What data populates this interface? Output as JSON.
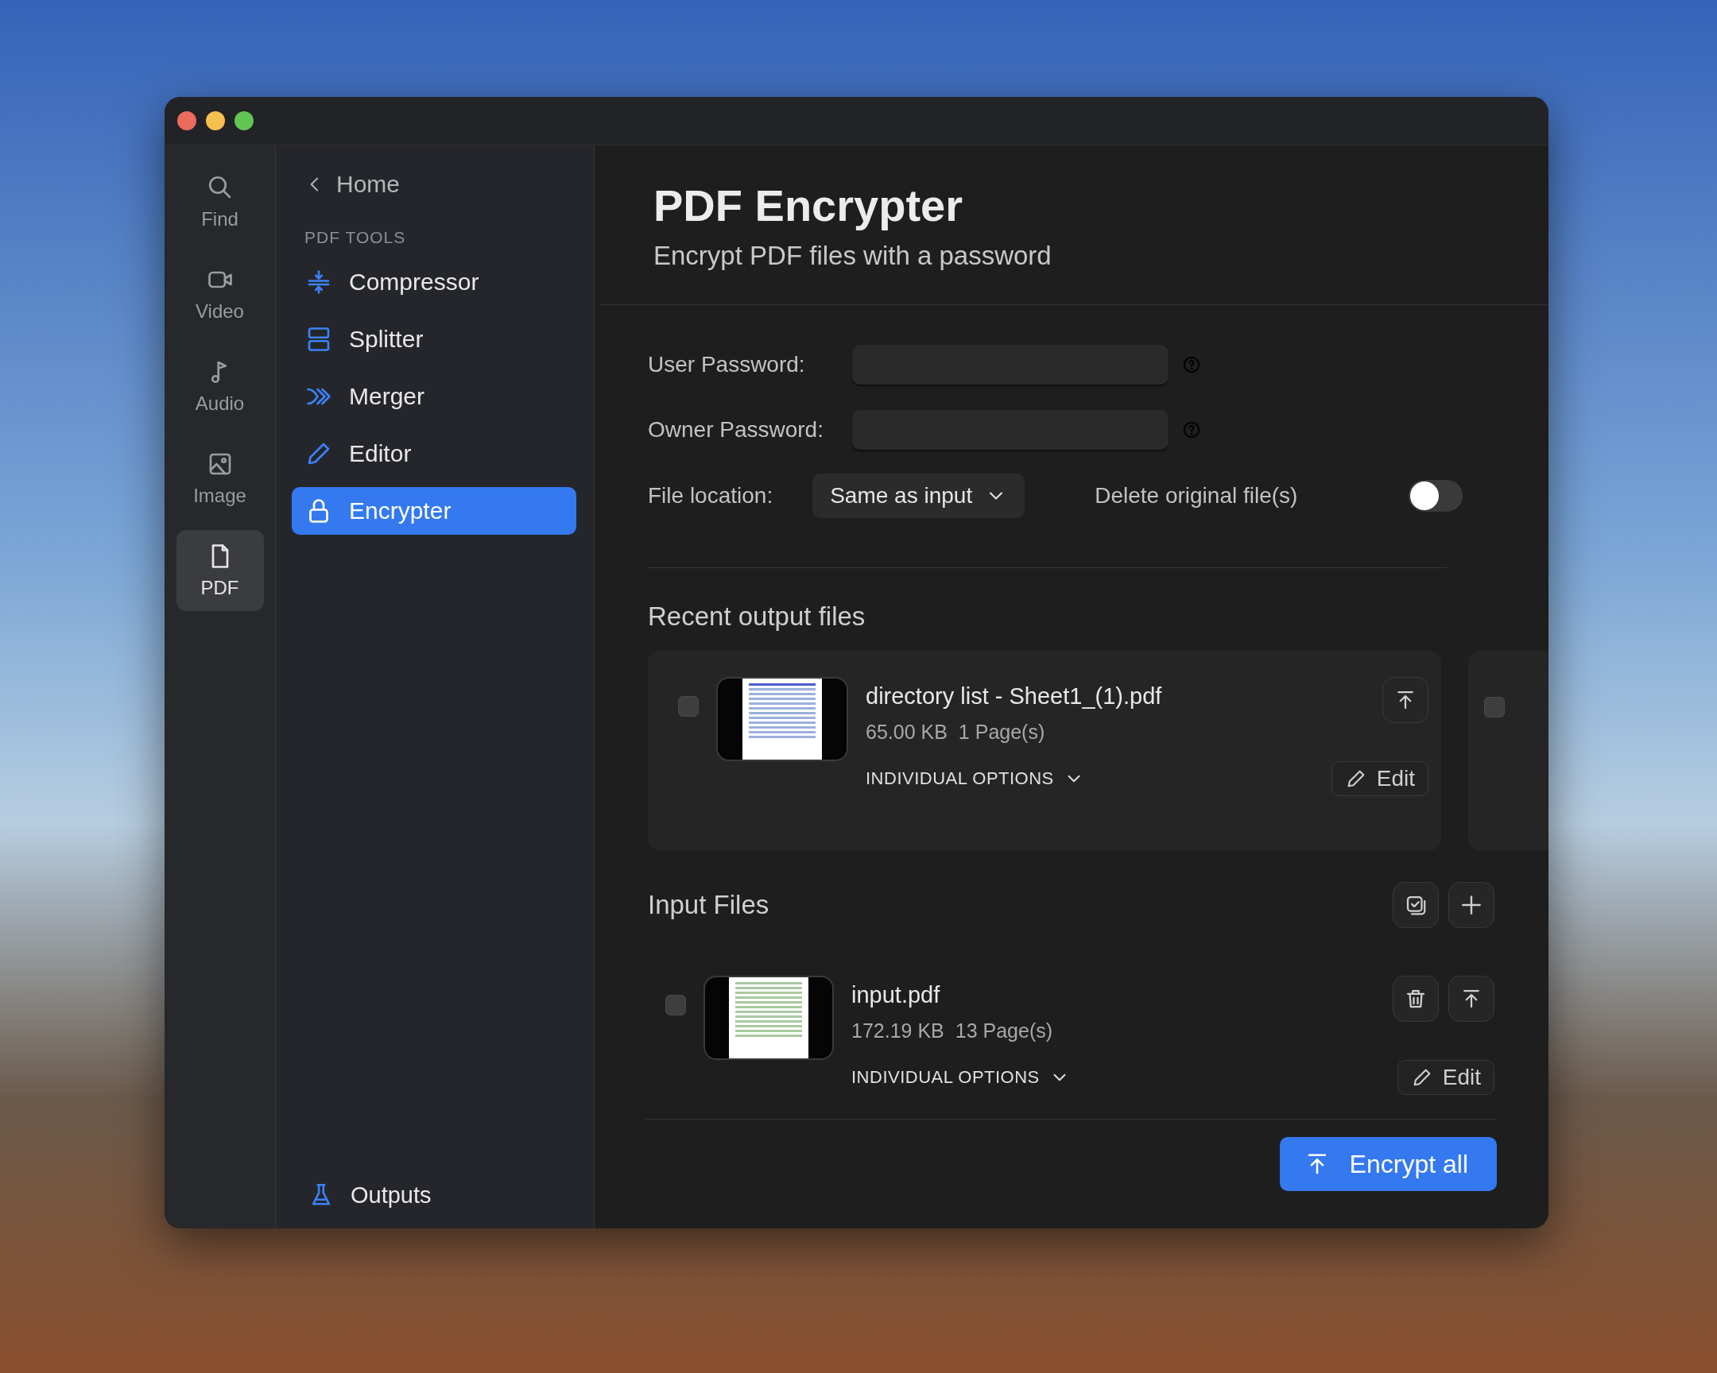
{
  "window": {
    "controls": [
      {
        "color": "#ed6a5e"
      },
      {
        "color": "#f5bf4f"
      },
      {
        "color": "#61c554"
      }
    ]
  },
  "rail": [
    {
      "label": "Find",
      "selected": false
    },
    {
      "label": "Video",
      "selected": false
    },
    {
      "label": "Audio",
      "selected": false
    },
    {
      "label": "Image",
      "selected": false
    },
    {
      "label": "PDF",
      "selected": true
    }
  ],
  "sidebar": {
    "back": "Home",
    "section": "PDF TOOLS",
    "items": [
      {
        "label": "Compressor",
        "selected": false
      },
      {
        "label": "Splitter",
        "selected": false
      },
      {
        "label": "Merger",
        "selected": false
      },
      {
        "label": "Editor",
        "selected": false
      },
      {
        "label": "Encrypter",
        "selected": true
      }
    ],
    "footer": "Outputs"
  },
  "header": {
    "title": "PDF Encrypter",
    "subtitle": "Encrypt PDF files with a password"
  },
  "form": {
    "user_password": {
      "label": "User Password:"
    },
    "owner_password": {
      "label": "Owner Password:"
    },
    "file_location": {
      "label": "File location:",
      "value": "Same as input"
    },
    "delete_original": {
      "label": "Delete original file(s)",
      "on": false
    }
  },
  "recent": {
    "title": "Recent output files",
    "files": [
      {
        "checked": false,
        "name": "directory list - Sheet1_(1).pdf",
        "size": "65.00 KB",
        "pages": "1 Page(s)",
        "options": "INDIVIDUAL OPTIONS",
        "edit": "Edit"
      },
      {
        "checked": false
      }
    ]
  },
  "input": {
    "title": "Input Files",
    "files": [
      {
        "checked": false,
        "name": "input.pdf",
        "size": "172.19 KB",
        "pages": "13 Page(s)",
        "options": "INDIVIDUAL OPTIONS",
        "edit": "Edit"
      }
    ]
  },
  "action": "Encrypt all"
}
